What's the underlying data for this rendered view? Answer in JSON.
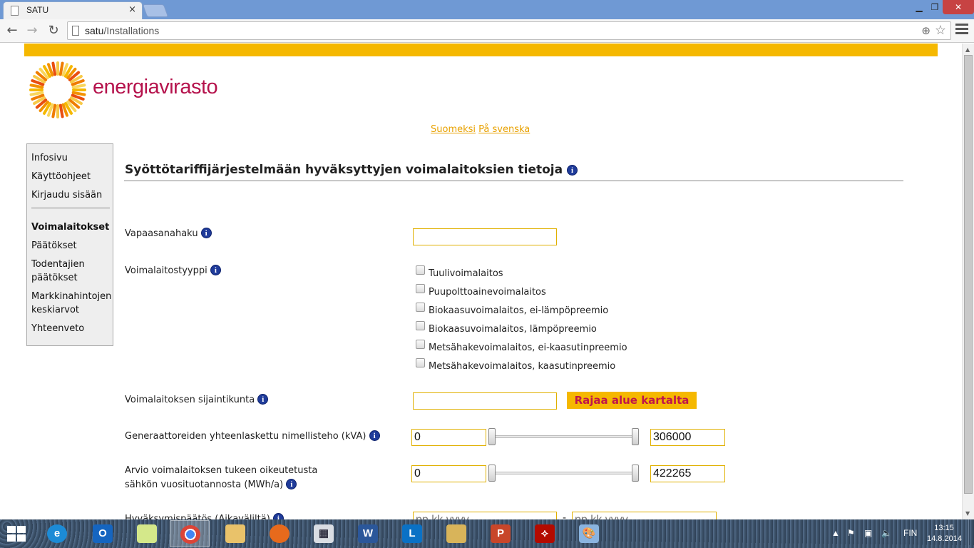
{
  "browser": {
    "tab_title": "SATU",
    "tab_close": "×",
    "url_host": "satu",
    "url_path": "/Installations"
  },
  "page": {
    "brand": "energiavirasto",
    "languages": [
      "Suomeksi",
      "På svenska"
    ],
    "sidebar": {
      "top_items": [
        "Infosivu",
        "Käyttöohjeet",
        "Kirjaudu sisään"
      ],
      "main_items": [
        "Voimalaitokset",
        "Päätökset",
        "Todentajien päätökset",
        "Markkinahintojen keskiarvot",
        "Yhteenveto"
      ],
      "active": "Voimalaitokset"
    },
    "heading": "Syöttötariffijärjestelmään hyväksyttyjen voimalaitoksien tietoja",
    "info_glyph": "i",
    "search": {
      "label": "Vapaasanahaku",
      "value": ""
    },
    "plant_type": {
      "label": "Voimalaitostyyppi",
      "options": [
        "Tuulivoimalaitos",
        "Puupolttoainevoimalaitos",
        "Biokaasuvoimalaitos, ei-lämpöpreemio",
        "Biokaasuvoimalaitos, lämpöpreemio",
        "Metsähakevoimalaitos, ei-kaasutinpreemio",
        "Metsähakevoimalaitos, kaasutinpreemio"
      ]
    },
    "municipality": {
      "label": "Voimalaitoksen sijaintikunta",
      "value": "",
      "map_button": "Rajaa alue kartalta"
    },
    "capacity": {
      "label": "Generaattoreiden yhteenlaskettu nimellisteho (kVA)",
      "min": "0",
      "max": "306000"
    },
    "production": {
      "label_line1": "Arvio voimalaitoksen tukeen oikeutetusta",
      "label_line2": "sähkön vuosituotannosta (MWh/a)",
      "min": "0",
      "max": "422265"
    },
    "decision": {
      "label": "Hyväksymispäätös (Aikaväliltä)",
      "from_placeholder": "pp.kk.vvvv",
      "to_placeholder": "pp.kk.vvvv",
      "separator": "-"
    }
  },
  "taskbar": {
    "language": "FIN",
    "time": "13:15",
    "date": "14.8.2014"
  }
}
